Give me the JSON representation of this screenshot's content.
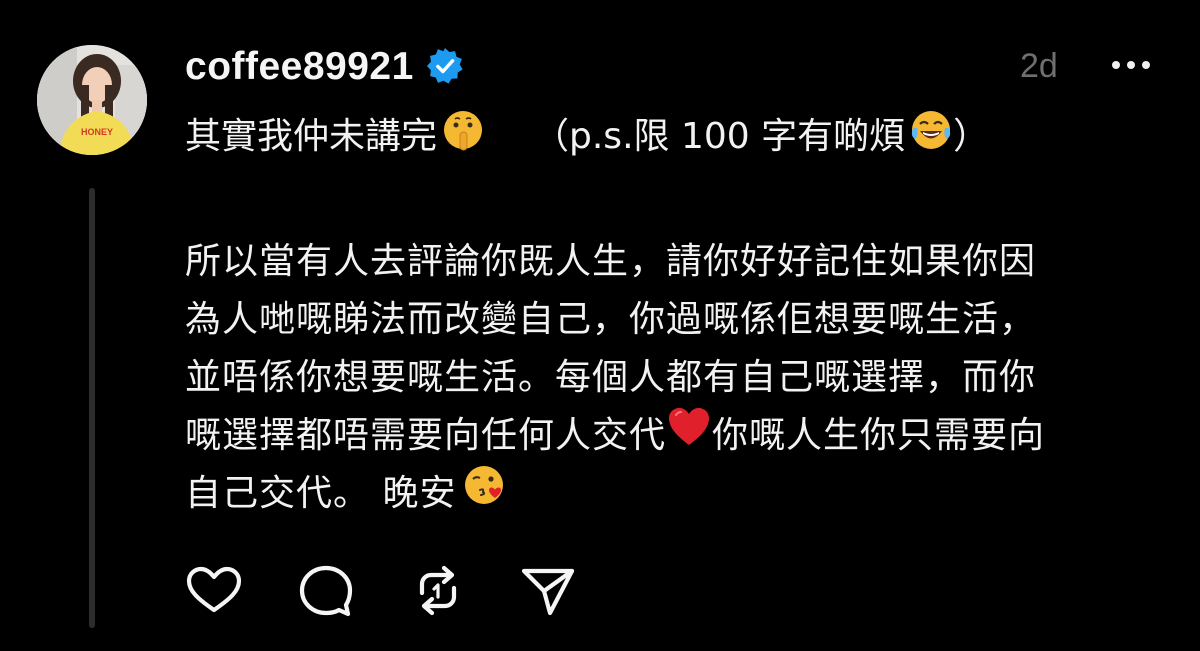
{
  "post": {
    "username": "coffee89921",
    "verified": true,
    "timestamp": "2d",
    "line1_text": "其實我仲未講完",
    "line1_emoji": "shushing-face",
    "line1_note": "（p.s.限 100 字有啲煩",
    "line1_note_emoji": "tears-of-joy",
    "line1_note_close": "）",
    "body_lines": [
      "所以當有人去評論你既人生，請你好好記住如果你因",
      "為人哋嘅睇法而改變自己，你過嘅係佢想要嘅生活，",
      "並唔係你想要嘅生活。每個人都有自己嘅選擇，而你"
    ],
    "body_line4_a": "嘅選擇都唔需要向任何人交代",
    "body_line4_emoji": "red-heart",
    "body_line4_b": "你嘅人生你只需要向",
    "body_line5": "自己交代。 晚安",
    "body_line5_emoji": "face-blowing-kiss",
    "avatar_shirt_text": "HONEY"
  },
  "icons": {
    "verified": "verified-badge-icon",
    "more": "more-options-icon",
    "like": "heart-icon",
    "comment": "comment-icon",
    "repost": "repost-icon",
    "share": "send-icon"
  },
  "colors": {
    "background": "#000000",
    "text": "#f2f2f2",
    "muted": "#6f6f6f",
    "verified": "#1d9bf0",
    "thread_line": "#2d2d2d",
    "heart": "#e0202a"
  }
}
